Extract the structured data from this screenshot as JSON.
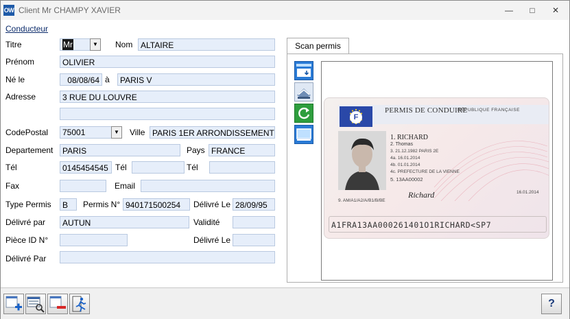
{
  "window": {
    "app_icon_text": "OW",
    "title": "Client Mr CHAMPY XAVIER"
  },
  "section": {
    "title": "Conducteur"
  },
  "form": {
    "titre_label": "Titre",
    "titre_value": "Mr",
    "nom_label": "Nom",
    "nom_value": "ALTAIRE",
    "prenom_label": "Prénom",
    "prenom_value": "OLIVIER",
    "ne_le_label": "Né le",
    "ne_le_value": "08/08/64",
    "a_label": "à",
    "birthplace_value": "PARIS V",
    "adresse_label": "Adresse",
    "adresse_value": "3 RUE DU LOUVRE",
    "adresse2_value": "",
    "codepostal_label": "CodePostal",
    "codepostal_value": "75001",
    "ville_label": "Ville",
    "ville_value": "PARIS 1ER ARRONDISSEMENT",
    "departement_label": "Departement",
    "departement_value": "PARIS",
    "pays_label": "Pays",
    "pays_value": "FRANCE",
    "tel_label": "Tél",
    "tel1_value": "0145454545",
    "tel2_label": "Tél",
    "tel2_value": "",
    "tel3_label": "Tél",
    "tel3_value": "",
    "fax_label": "Fax",
    "fax_value": "",
    "email_label": "Email",
    "email_value": "",
    "type_permis_label": "Type Permis",
    "type_permis_value": "B",
    "permis_no_label": "Permis N°",
    "permis_no_value": "940171500254",
    "delivre_le_label": "Délivré Le",
    "delivre_le_value": "28/09/95",
    "delivre_par_label": "Délivré par",
    "delivre_par_value": "AUTUN",
    "validite_label": "Validité",
    "validite_value": "",
    "piece_id_label": "Pièce ID N°",
    "piece_id_value": "",
    "piece_delivre_le_label": "Délivré Le",
    "piece_delivre_le_value": "",
    "piece_delivre_par_label": "Délivré Par",
    "piece_delivre_par_value": ""
  },
  "scan": {
    "tab_label": "Scan permis",
    "tools": [
      "scanner-download-icon",
      "scanner-icon",
      "rotate-icon",
      "view-icon"
    ],
    "card": {
      "flag_letter": "F",
      "title": "PERMIS DE CONDUIRE",
      "subtitle": "RÉPUBLIQUE FRANÇAISE",
      "name": "1. RICHARD",
      "given": "2. Thomas",
      "line3": "3. 21.12.1982 PARIS 2E",
      "line4a": "4a. 16.01.2014",
      "line4b": "4b. 01.01.2014",
      "line4c": "4c. PREFECTURE DE LA VIENNE",
      "line5": "5. 13AA00002",
      "line9": "9. AM/A1/A2/A/B1/B/BE",
      "date_right": "16.01.2014",
      "signature": "Richard",
      "mrz": "A1FRA13AA000261401O1RICHARD<SP7"
    }
  },
  "toolbar": {
    "buttons": [
      "add-icon",
      "search-record-icon",
      "delete-icon",
      "exit-icon"
    ],
    "help_label": "?"
  },
  "colors": {
    "field_bg": "#e6eefa",
    "field_border": "#b9c9e0",
    "link": "#0a2a6a",
    "accent_blue": "#2a7bd6",
    "accent_green": "#2e9e3e"
  }
}
